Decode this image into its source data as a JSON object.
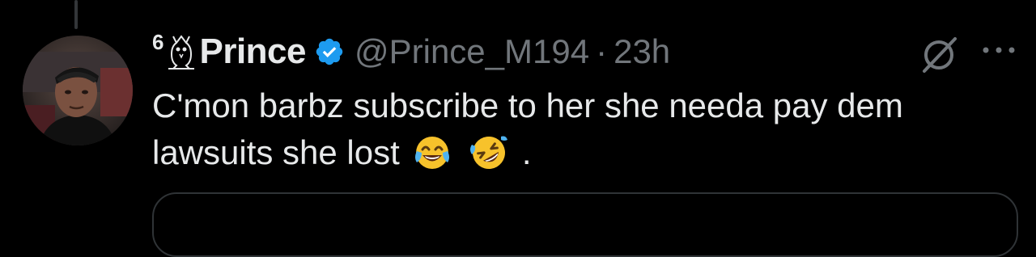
{
  "tweet": {
    "name_prefix": "6",
    "display_name": "Prince",
    "handle": "@Prince_M194",
    "separator": "·",
    "time": "23h",
    "text_main": "C'mon barbz subscribe to her she needa pay dem lawsuits she lost",
    "text_end": ".",
    "emojis": [
      "face-with-tears-of-joy",
      "rolling-on-the-floor-laughing"
    ]
  },
  "icons": {
    "owl": "owl-icon",
    "verified": "verified-badge-icon",
    "grok": "grok-icon",
    "more": "more-options-icon"
  },
  "colors": {
    "background": "#000000",
    "primary_text": "#e7e9ea",
    "secondary_text": "#71767b",
    "verified_blue": "#1d9bf0",
    "border": "#2f3336"
  }
}
